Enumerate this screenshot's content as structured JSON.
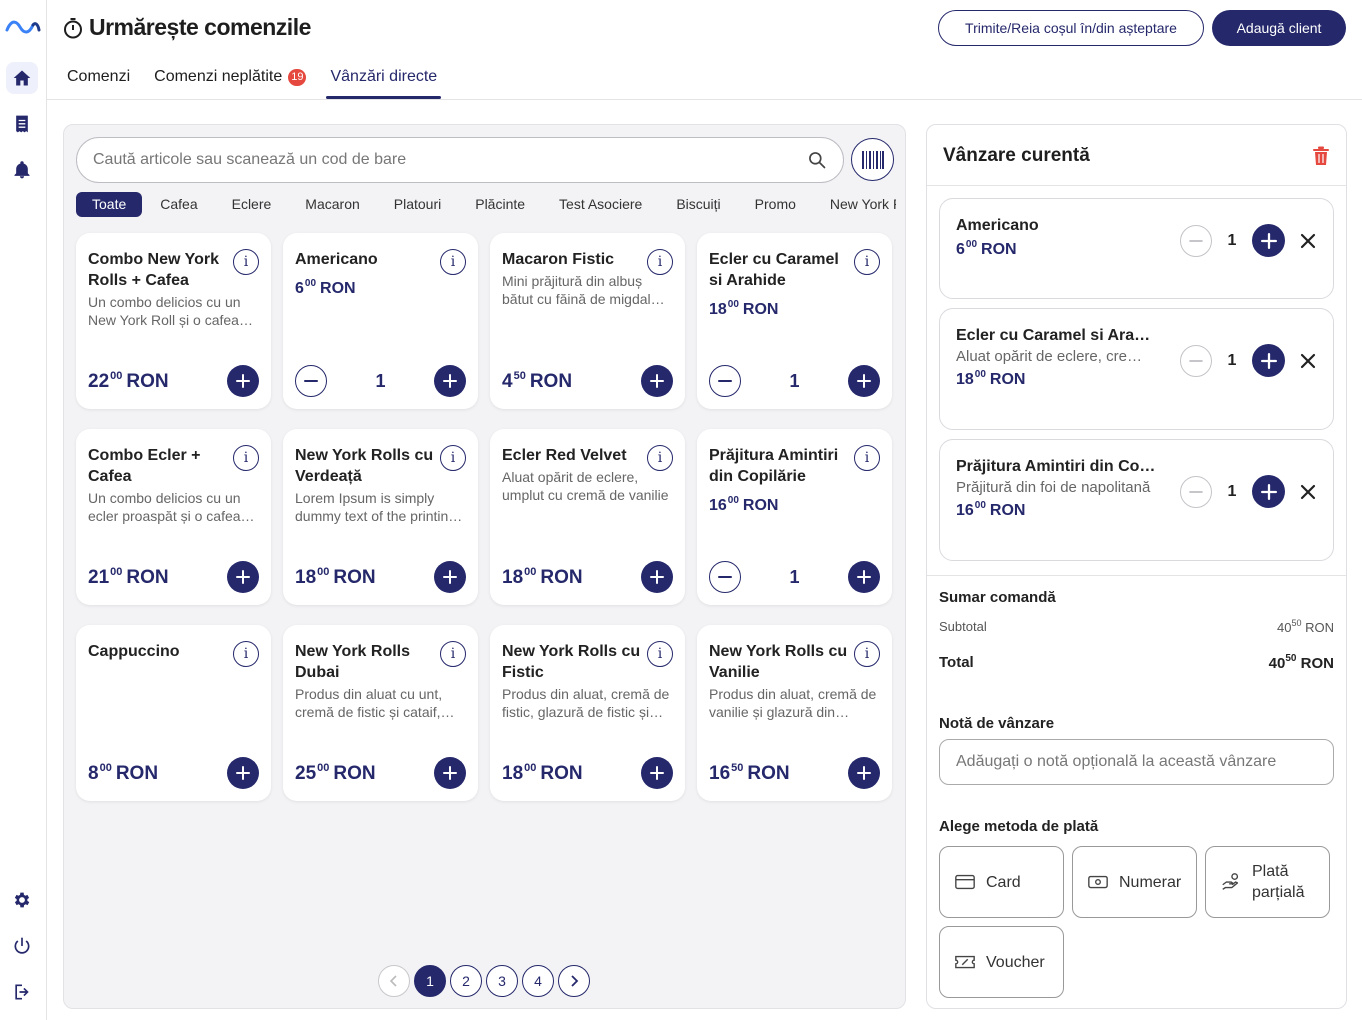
{
  "rail": {
    "items": [
      "home",
      "orders",
      "notifications",
      "settings",
      "power",
      "logout"
    ]
  },
  "header": {
    "title": "Urmărește comenzile",
    "tabs": [
      {
        "label": "Comenzi"
      },
      {
        "label": "Comenzi neplătite",
        "badge": "19"
      },
      {
        "label": "Vânzări directe",
        "active": true
      }
    ],
    "send_cart_label": "Trimite/Reia coșul în/din așteptare",
    "add_client_label": "Adaugă client"
  },
  "catalog": {
    "search_placeholder": "Caută articole sau scanează un cod de bare",
    "categories": [
      "Toate",
      "Cafea",
      "Eclere",
      "Macaron",
      "Platouri",
      "Plăcinte",
      "Test Asociere",
      "Biscuiți",
      "Promo",
      "New York Rolls"
    ],
    "active_category": "Toate",
    "currency": "RON",
    "products": [
      {
        "name": "Combo New York Rolls + Cafea",
        "desc": "Un combo delicios cu un New York Roll și o cafea preferată",
        "int": "22",
        "dec": "00",
        "qty": null
      },
      {
        "name": "Americano",
        "desc": "",
        "int": "6",
        "dec": "00",
        "qty": "1"
      },
      {
        "name": "Macaron Fistic",
        "desc": "Mini prăjitură din albuș bătut cu făină de migdale și cremă de fistic",
        "int": "4",
        "dec": "50",
        "qty": null
      },
      {
        "name": "Ecler cu Caramel si Arahide",
        "desc": "",
        "int": "18",
        "dec": "00",
        "qty": "1"
      },
      {
        "name": "Combo Ecler + Cafea",
        "desc": "Un combo delicios cu un ecler proaspăt și o cafea aromată",
        "int": "21",
        "dec": "00",
        "qty": null
      },
      {
        "name": "New York Rolls cu Verdeață",
        "desc": "Lorem Ipsum is simply dummy text of the printing industry",
        "int": "18",
        "dec": "00",
        "qty": null
      },
      {
        "name": "Ecler Red Velvet",
        "desc": "Aluat opărit de eclere, umplut cu cremă de vanilie",
        "int": "18",
        "dec": "00",
        "qty": null
      },
      {
        "name": "Prăjitura Amintiri din Copilărie",
        "desc": "",
        "int": "16",
        "dec": "00",
        "qty": "1"
      },
      {
        "name": "Cappuccino",
        "desc": "",
        "int": "8",
        "dec": "00",
        "qty": null
      },
      {
        "name": "New York Rolls Dubai",
        "desc": "Produs din aluat cu unt, cremă de fistic și cataif, glazură",
        "int": "25",
        "dec": "00",
        "qty": null
      },
      {
        "name": "New York Rolls cu Fistic",
        "desc": "Produs din aluat, cremă de fistic, glazură de fistic și fistic",
        "int": "18",
        "dec": "00",
        "qty": null
      },
      {
        "name": "New York Rolls cu Vanilie",
        "desc": "Produs din aluat, cremă de vanilie și glazură din ciocolată",
        "int": "16",
        "dec": "50",
        "qty": null
      }
    ],
    "pagination": {
      "pages": [
        "1",
        "2",
        "3",
        "4"
      ],
      "current": "1"
    }
  },
  "sale": {
    "title": "Vânzare curentă",
    "items": [
      {
        "name": "Americano",
        "desc": "",
        "int": "6",
        "dec": "00",
        "qty": "1"
      },
      {
        "name": "Ecler cu Caramel si Arahide",
        "desc": "Aluat opărit de eclere, cremă de caramel și arahide",
        "int": "18",
        "dec": "00",
        "qty": "1"
      },
      {
        "name": "Prăjitura Amintiri din Copilărie",
        "desc": "Prăjitură din foi de napolitană",
        "int": "16",
        "dec": "00",
        "qty": "1"
      }
    ],
    "summary": {
      "title": "Sumar comandă",
      "subtotal_label": "Subtotal",
      "subtotal_int": "40",
      "subtotal_dec": "50",
      "total_label": "Total",
      "total_int": "40",
      "total_dec": "50",
      "currency": "RON"
    },
    "note_label": "Notă de vânzare",
    "note_placeholder": "Adăugați o notă opțională la această vânzare",
    "payment_label": "Alege metoda de plată",
    "payment_methods": [
      {
        "label": "Card",
        "icon": "card-icon"
      },
      {
        "label": "Numerar",
        "icon": "cash-icon"
      },
      {
        "label": "Plată parțială",
        "icon": "partial-payment-icon"
      },
      {
        "label": "Voucher",
        "icon": "voucher-icon"
      }
    ]
  },
  "colors": {
    "accent": "#25286b",
    "badge": "#e5483e",
    "trash": "#e5483e"
  }
}
